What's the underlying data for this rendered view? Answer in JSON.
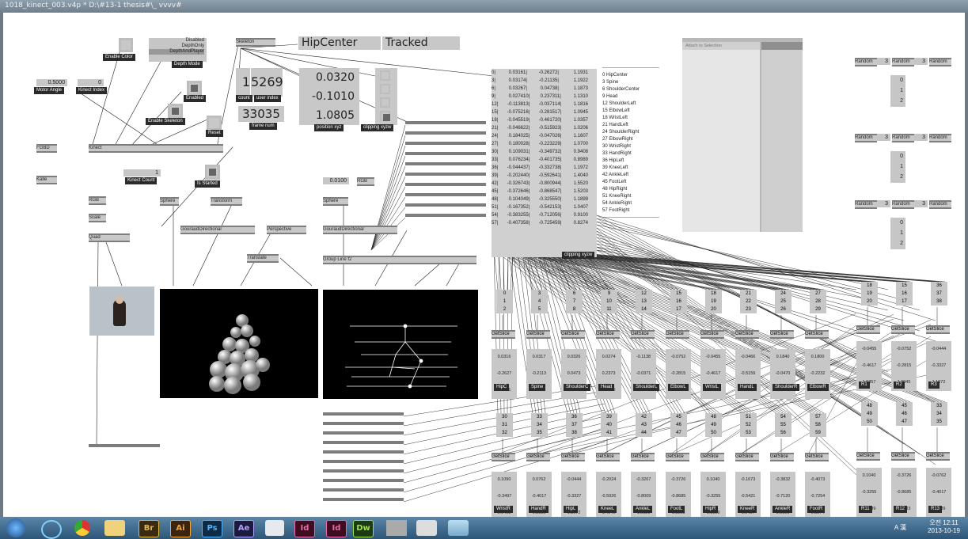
{
  "window": {
    "title": "1018_kinect_003.v4p *   D:\\#13-1 thesis#\\_ vvvv#"
  },
  "kinect_controls": {
    "enable_color": "Enable Color",
    "depth_options": [
      "Disabled",
      "DepthOnly",
      "DepthAndPlayer"
    ],
    "depth_mode": "Depth Mode",
    "motor_angle_value": "0.5000",
    "motor_angle": "Motor Angle",
    "kinect_index_value": "0",
    "kinect_index": "Kinect Index",
    "enabled": "Enabled",
    "enable_skeleton": "Enable Skeleton",
    "reset": "Reset",
    "kinect_node": "Kinect",
    "kinect_count_value": "1",
    "kinect_count": "Kinect Count",
    "is_started": "Is Started"
  },
  "skeleton": {
    "node": "Skeleton",
    "joint_name": "HipCenter",
    "status": "Tracked",
    "count_value": "1",
    "user_index_value": "5269",
    "count": "count",
    "user_index": "user index",
    "frame_num_value": "33035",
    "frame_num": "frame num",
    "position_xyz": [
      "0.0320",
      "-0.1010",
      "1.0805"
    ],
    "position_label": "position xyz",
    "clipping_label": "clipping xyzw"
  },
  "nodes": {
    "rgb1": "FGBD",
    "kalle": "Kalle",
    "rgb2": "RGB",
    "scale": "Scale",
    "quad": "Quad",
    "sphere1": "Sphere",
    "transform": "Transform",
    "gouraud1": "GouraudDirectional",
    "perspective": "Perspective",
    "translate": "Translate",
    "sphere2": "Sphere",
    "gouraud2": "GouraudDirectional",
    "value_0100": "0.0100",
    "rgb3": "RGB",
    "group_line": "Group    Line f2",
    "attach_to_selection": "Attach to Selection",
    "random": "Random",
    "random_value": "3",
    "getslice": "GetSlice"
  },
  "position_table": [
    [
      "0|",
      "0.0316",
      "1|",
      "-0.2627",
      "2|",
      "1.1931"
    ],
    [
      "3|",
      "0.0317",
      "4|",
      "-0.2113",
      "5|",
      "1.1922"
    ],
    [
      "6|",
      "0.0326",
      "7|",
      "0.0473",
      "8|",
      "1.1873"
    ],
    [
      "9|",
      "0.0274",
      "10|",
      "0.2373",
      "11|",
      "1.1310"
    ],
    [
      "12|",
      "-0.1138",
      "13|",
      "-0.0371",
      "14|",
      "1.1816"
    ],
    [
      "15|",
      "-0.0752",
      "16|",
      "-0.2815",
      "17|",
      "1.0945"
    ],
    [
      "18|",
      "-0.0455",
      "19|",
      "-0.4617",
      "20|",
      "1.0357"
    ],
    [
      "21|",
      "-0.0466",
      "22|",
      "-0.5159",
      "23|",
      "1.0206"
    ],
    [
      "24|",
      "0.1840",
      "25|",
      "-0.0470",
      "26|",
      "1.1607"
    ],
    [
      "27|",
      "0.1800",
      "28|",
      "-0.2232",
      "29|",
      "1.0700"
    ],
    [
      "30|",
      "0.1090",
      "31|",
      "-0.3497",
      "32|",
      "0.9408"
    ],
    [
      "33|",
      "0.0762",
      "34|",
      "-0.4017",
      "35|",
      "0.8989"
    ],
    [
      "36|",
      "-0.0444",
      "37|",
      "-0.3327",
      "38|",
      "1.1972"
    ],
    [
      "39|",
      "-0.2024",
      "40|",
      "-0.5926",
      "41|",
      "1.4040"
    ],
    [
      "42|",
      "-0.3267",
      "43|",
      "-0.8009",
      "44|",
      "1.5520"
    ],
    [
      "45|",
      "-0.3726",
      "46|",
      "-0.8685",
      "47|",
      "1.5203"
    ],
    [
      "48|",
      "0.1040",
      "49|",
      "-0.3255",
      "50|",
      "1.1899"
    ],
    [
      "51|",
      "-0.1673",
      "52|",
      "-0.5421",
      "53|",
      "1.0407"
    ],
    [
      "54|",
      "-0.3832",
      "55|",
      "-0.7120",
      "56|",
      "0.9100"
    ],
    [
      "57|",
      "-0.4073",
      "58|",
      "-0.7254",
      "59|",
      "0.8274"
    ]
  ],
  "joint_list": [
    "------------------------------------",
    "0 HipCenter",
    "3 Spine",
    "6 ShoulderCenter",
    "9 Head",
    "12 ShoulderLeft",
    "15 ElbowLeft",
    "18 WristLeft",
    "21 HandLeft",
    "24 ShoulderRight",
    "27 ElbowRight",
    "30 WristRight",
    "33 HandRight",
    "36 HipLeft",
    "39 KneeLeft",
    "42 AnkleLeft",
    "45 FootLeft",
    "48 HipRight",
    "51 KneeRight",
    "54 AnkleRight",
    "57 FootRight",
    "------------------------------------"
  ],
  "row1": [
    {
      "idx": [
        "0",
        "1",
        "2"
      ],
      "vals": [
        "0.0316",
        "-0.2627",
        "1.1931"
      ],
      "label": "HipC"
    },
    {
      "idx": [
        "3",
        "4",
        "5"
      ],
      "vals": [
        "0.0317",
        "-0.2113",
        "1.1922"
      ],
      "label": "Spine"
    },
    {
      "idx": [
        "6",
        "7",
        "8"
      ],
      "vals": [
        "0.0326",
        "0.0473",
        "1.1873"
      ],
      "label": "ShoulderC"
    },
    {
      "idx": [
        "9",
        "10",
        "11"
      ],
      "vals": [
        "0.0274",
        "0.2373",
        "1.1310"
      ],
      "label": "Head"
    },
    {
      "idx": [
        "12",
        "13",
        "14"
      ],
      "vals": [
        "-0.1138",
        "-0.0371",
        "1.1816"
      ],
      "label": "ShoulderL"
    },
    {
      "idx": [
        "15",
        "16",
        "17"
      ],
      "vals": [
        "-0.0752",
        "-0.2815",
        "1.0945"
      ],
      "label": "ElbowL"
    },
    {
      "idx": [
        "18",
        "19",
        "20"
      ],
      "vals": [
        "-0.0455",
        "-0.4617",
        "1.0357"
      ],
      "label": "WristL"
    },
    {
      "idx": [
        "21",
        "22",
        "23"
      ],
      "vals": [
        "-0.0466",
        "-0.5159",
        "1.0206"
      ],
      "label": "HandL"
    },
    {
      "idx": [
        "24",
        "25",
        "26"
      ],
      "vals": [
        "0.1840",
        "-0.0470",
        "1.1607"
      ],
      "label": "ShoulderR"
    },
    {
      "idx": [
        "27",
        "28",
        "29"
      ],
      "vals": [
        "0.1800",
        "-0.2232",
        "1.0700"
      ],
      "label": "ElbowR"
    }
  ],
  "row2": [
    {
      "idx": [
        "30",
        "31",
        "32"
      ],
      "vals": [
        "0.1090",
        "-0.3497",
        "0.9408"
      ],
      "label": "WristR"
    },
    {
      "idx": [
        "33",
        "34",
        "35"
      ],
      "vals": [
        "0.0762",
        "-0.4017",
        "0.8989"
      ],
      "label": "HandR"
    },
    {
      "idx": [
        "36",
        "37",
        "38"
      ],
      "vals": [
        "-0.0444",
        "-0.3327",
        "1.1972"
      ],
      "label": "HipL"
    },
    {
      "idx": [
        "39",
        "40",
        "41"
      ],
      "vals": [
        "-0.2024",
        "-0.5926",
        "1.4040"
      ],
      "label": "KneeL"
    },
    {
      "idx": [
        "42",
        "43",
        "44"
      ],
      "vals": [
        "-0.3267",
        "-0.8009",
        "1.5520"
      ],
      "label": "AnkleL"
    },
    {
      "idx": [
        "45",
        "46",
        "47"
      ],
      "vals": [
        "-0.3726",
        "-0.8685",
        "1.5203"
      ],
      "label": "FootL"
    },
    {
      "idx": [
        "48",
        "49",
        "50"
      ],
      "vals": [
        "0.1040",
        "-0.3255",
        "1.1899"
      ],
      "label": "HipR"
    },
    {
      "idx": [
        "51",
        "52",
        "53"
      ],
      "vals": [
        "-0.1673",
        "-0.5421",
        "1.0407"
      ],
      "label": "KneeR"
    },
    {
      "idx": [
        "54",
        "55",
        "56"
      ],
      "vals": [
        "-0.3832",
        "-0.7120",
        "0.9100"
      ],
      "label": "AnkleR"
    },
    {
      "idx": [
        "57",
        "58",
        "59"
      ],
      "vals": [
        "-0.4073",
        "-0.7254",
        "0.8274"
      ],
      "label": "FootR"
    }
  ],
  "right_col1": [
    {
      "idx": [
        "18",
        "19",
        "20"
      ],
      "vals": [
        "-0.0455",
        "-0.4617",
        "1.0357"
      ],
      "label": "R1"
    },
    {
      "idx": [
        "15",
        "16",
        "17"
      ],
      "vals": [
        "-0.0752",
        "-0.2815",
        "1.0945"
      ],
      "label": "R2"
    },
    {
      "idx": [
        "36",
        "37",
        "38"
      ],
      "vals": [
        "-0.0444",
        "-0.3327",
        "1.1972"
      ],
      "label": "R3"
    }
  ],
  "right_col2": [
    {
      "idx": [
        "48",
        "49",
        "50"
      ],
      "vals": [
        "0.1040",
        "-0.3255",
        "1.1899"
      ],
      "label": "R11"
    },
    {
      "idx": [
        "45",
        "46",
        "47"
      ],
      "vals": [
        "-0.3726",
        "-0.8685",
        "1.5203"
      ],
      "label": "R12"
    },
    {
      "idx": [
        "33",
        "34",
        "35"
      ],
      "vals": [
        "-0.0762",
        "-0.4017",
        "0.8989"
      ],
      "label": "R13"
    }
  ],
  "random_outputs": [
    "0",
    "1",
    "2"
  ],
  "taskbar": {
    "apps": [
      "Br",
      "Ai",
      "Ps",
      "Ae",
      "Id",
      "Id",
      "Dw"
    ],
    "time": "오전 12:11",
    "date": "2013-10-19",
    "tray": "A 漢"
  }
}
